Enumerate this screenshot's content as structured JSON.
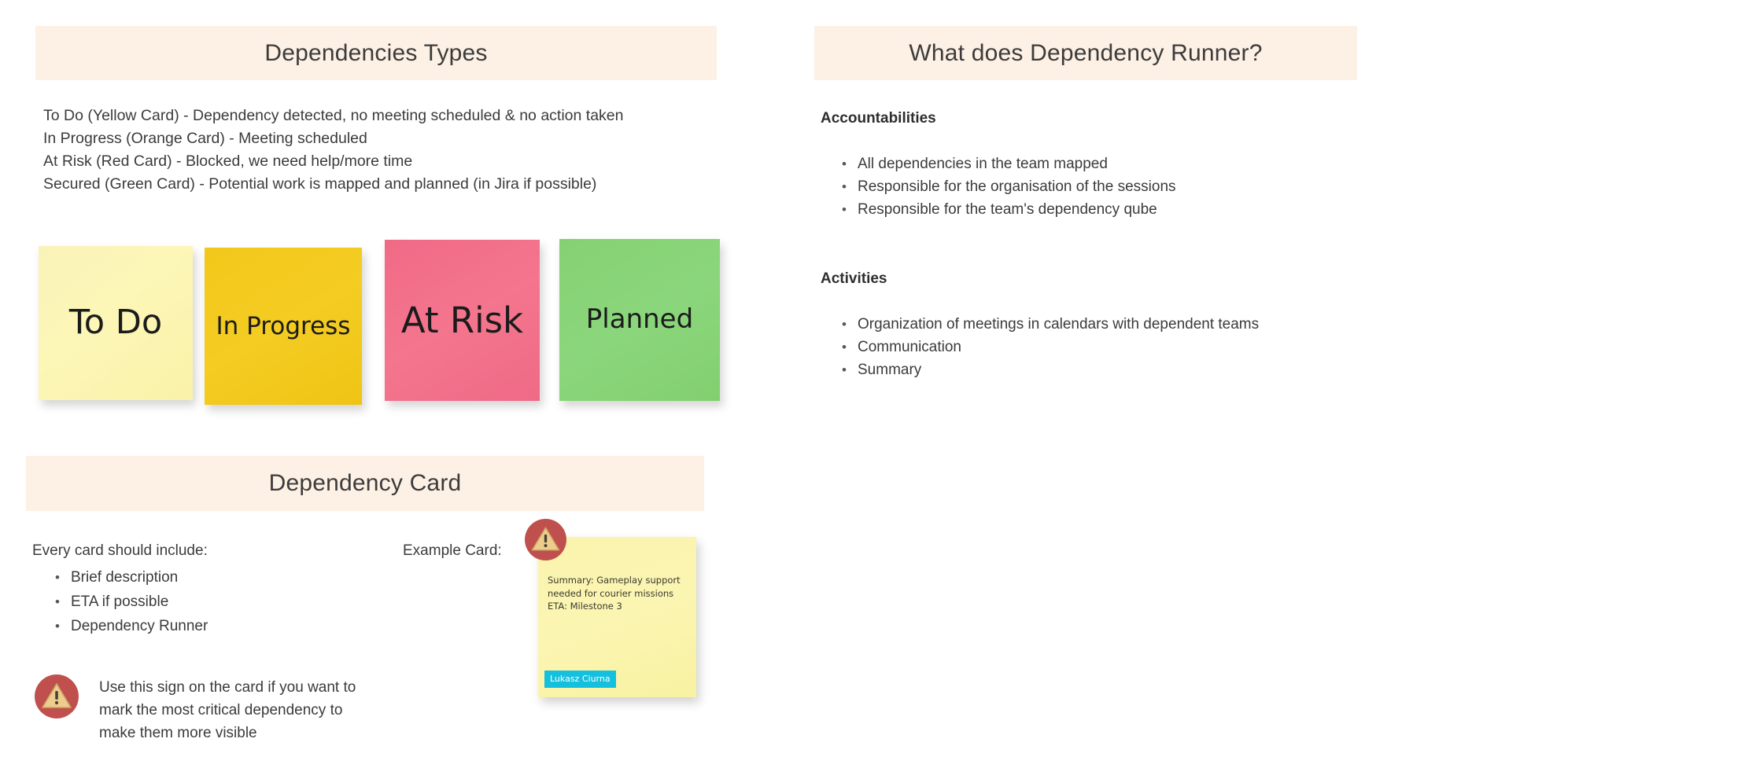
{
  "left": {
    "dependencies_types": {
      "banner_title": "Dependencies Types",
      "description_lines": [
        "To Do (Yellow Card) - Dependency detected, no meeting scheduled & no action taken",
        "In Progress (Orange Card) - Meeting scheduled",
        "At Risk (Red Card) - Blocked, we need help/more time",
        "Secured (Green Card) - Potential work is mapped and planned (in Jira if possible)"
      ],
      "sticky_notes": [
        {
          "label": "To Do",
          "color": "#FBF4B3",
          "name": "sticky-note-to-do"
        },
        {
          "label": "In Progress",
          "color": "#F3C91E",
          "name": "sticky-note-in-progress"
        },
        {
          "label": "At Risk",
          "color": "#F2718B",
          "name": "sticky-note-at-risk"
        },
        {
          "label": "Planned",
          "color": "#87D375",
          "name": "sticky-note-planned"
        }
      ]
    },
    "dependency_card": {
      "banner_title": "Dependency Card",
      "intro": "Every card should include:",
      "include_items": [
        "Brief description",
        "ETA if possible",
        "Dependency Runner"
      ],
      "warning_note": "Use this sign on the card if you want to mark the most critical dependency to make them more visible",
      "example_card_label": "Example Card:",
      "example_card": {
        "summary": "Summary: Gameplay support needed for courier missions",
        "eta": "ETA: Milestone 3",
        "author": "Lukasz Ciurna",
        "author_badge_color": "#15C0DE",
        "background": "#FAF4AE"
      }
    }
  },
  "right": {
    "banner_title": "What does Dependency Runner?",
    "sections": [
      {
        "heading": "Accountabilities",
        "items": [
          "All dependencies in the team mapped",
          "Responsible for the organisation of the sessions",
          "Responsible for the team's dependency qube"
        ]
      },
      {
        "heading": "Activities",
        "items": [
          "Organization of meetings in calendars with dependent teams",
          "Communication",
          "Summary"
        ]
      }
    ]
  },
  "theme": {
    "banner_background": "#FDF0E4",
    "page_background": "#FFFFFF",
    "text_color": "#3B3B3B",
    "warning_circle_color": "#C0504D",
    "warning_triangle_color": "#EECC8C"
  }
}
